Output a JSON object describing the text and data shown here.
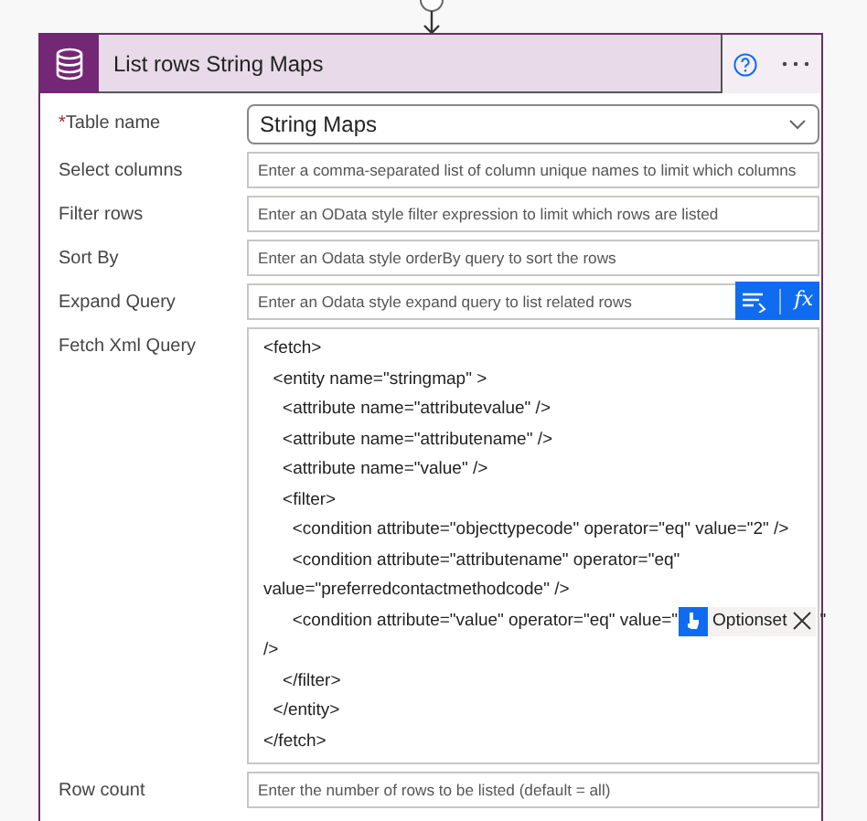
{
  "card": {
    "title": "List rows String Maps"
  },
  "fields": [
    {
      "label": "Table name",
      "required_text": "*",
      "kind": "dropdown",
      "value": "String Maps"
    },
    {
      "label": "Select columns",
      "kind": "input",
      "placeholder": "Enter a comma-separated list of column unique names to limit which columns"
    },
    {
      "label": "Filter rows",
      "kind": "input",
      "placeholder": "Enter an OData style filter expression to limit which rows are listed"
    },
    {
      "label": "Sort By",
      "kind": "input",
      "placeholder": "Enter an Odata style orderBy query to sort the rows"
    },
    {
      "label": "Expand Query",
      "kind": "input",
      "placeholder": "Enter an Odata style expand query to list related rows",
      "tools": {
        "expression_label": "fx"
      }
    },
    {
      "label": "Fetch Xml Query",
      "kind": "code",
      "lines": [
        {
          "text": "<fetch>"
        },
        {
          "text": "  <entity name=\"stringmap\" >"
        },
        {
          "text": "    <attribute name=\"attributevalue\" />"
        },
        {
          "text": "    <attribute name=\"attributename\" />"
        },
        {
          "text": "    <attribute name=\"value\" />"
        },
        {
          "text": "    <filter>"
        },
        {
          "text": "      <condition attribute=\"objecttypecode\" operator=\"eq\" value=\"2\" />"
        },
        {
          "text": "      <condition attribute=\"attributename\" operator=\"eq\""
        },
        {
          "text": "value=\"preferredcontactmethodcode\" />"
        },
        {
          "text": "      <condition attribute=\"value\" operator=\"eq\" value=\"",
          "token": "Optionset",
          "after": "\""
        },
        {
          "text": "/>"
        },
        {
          "text": "    </filter>"
        },
        {
          "text": "  </entity>"
        },
        {
          "text": "</fetch>"
        }
      ]
    },
    {
      "label": "Row count",
      "kind": "input",
      "placeholder": "Enter the number of rows to be listed (default = all)"
    }
  ]
}
